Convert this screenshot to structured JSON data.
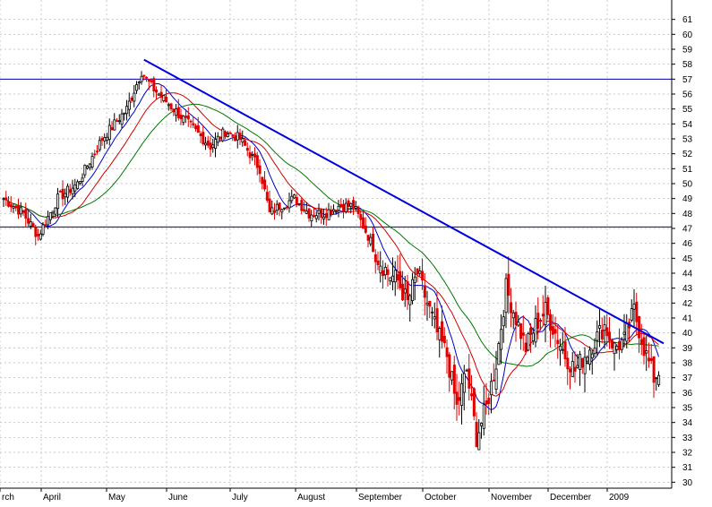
{
  "chart_data": {
    "type": "candlestick",
    "title": "",
    "xlabel": "",
    "ylabel": "",
    "ylim": [
      30,
      62
    ],
    "y_ticks": [
      30,
      31,
      32,
      33,
      34,
      35,
      36,
      37,
      38,
      39,
      40,
      41,
      42,
      43,
      44,
      45,
      46,
      47,
      48,
      49,
      50,
      51,
      52,
      53,
      54,
      55,
      56,
      57,
      58,
      59,
      60,
      61
    ],
    "x_months": [
      "rch",
      "April",
      "May",
      "June",
      "July",
      "August",
      "September",
      "October",
      "November",
      "December",
      "2009"
    ],
    "grid": true,
    "colors": {
      "up_candle": "#000000",
      "down_candle": "#e00000",
      "ma_short": "#0000cc",
      "ma_mid": "#d00000",
      "ma_long": "#007700",
      "trendline": "#0000dd",
      "horizontal_lines": "#0000aa",
      "grid": "#c8c8c8"
    },
    "horizontal_levels": [
      57,
      47.1
    ],
    "trendline": {
      "from": {
        "day": 57,
        "price": 58.3
      },
      "to": {
        "day": 268,
        "price": 39.3
      }
    },
    "anchors": [
      [
        0,
        49.0
      ],
      [
        8,
        48.0
      ],
      [
        14,
        46.5
      ],
      [
        22,
        49.0
      ],
      [
        30,
        50.0
      ],
      [
        40,
        53.0
      ],
      [
        50,
        55.0
      ],
      [
        56,
        57.5
      ],
      [
        60,
        56.5
      ],
      [
        66,
        55.5
      ],
      [
        72,
        54.5
      ],
      [
        78,
        53.5
      ],
      [
        84,
        52.5
      ],
      [
        90,
        53.5
      ],
      [
        96,
        53.0
      ],
      [
        104,
        51.0
      ],
      [
        108,
        48.0
      ],
      [
        112,
        48.5
      ],
      [
        118,
        49.0
      ],
      [
        124,
        48.0
      ],
      [
        130,
        48.0
      ],
      [
        136,
        48.5
      ],
      [
        142,
        48.5
      ],
      [
        148,
        46.5
      ],
      [
        152,
        45.0
      ],
      [
        156,
        44.0
      ],
      [
        160,
        43.5
      ],
      [
        164,
        42.0
      ],
      [
        168,
        44.0
      ],
      [
        172,
        42.0
      ],
      [
        176,
        40.0
      ],
      [
        180,
        38.5
      ],
      [
        184,
        35.0
      ],
      [
        188,
        37.5
      ],
      [
        192,
        33.0
      ],
      [
        196,
        35.0
      ],
      [
        200,
        38.0
      ],
      [
        204,
        43.0
      ],
      [
        208,
        41.0
      ],
      [
        212,
        39.0
      ],
      [
        216,
        40.5
      ],
      [
        220,
        41.5
      ],
      [
        224,
        40.0
      ],
      [
        228,
        38.5
      ],
      [
        232,
        37.5
      ],
      [
        236,
        38.5
      ],
      [
        240,
        39.5
      ],
      [
        244,
        40.5
      ],
      [
        248,
        39.0
      ],
      [
        252,
        39.5
      ],
      [
        256,
        41.5
      ],
      [
        260,
        39.0
      ],
      [
        264,
        37.0
      ],
      [
        266,
        37.4
      ]
    ]
  }
}
